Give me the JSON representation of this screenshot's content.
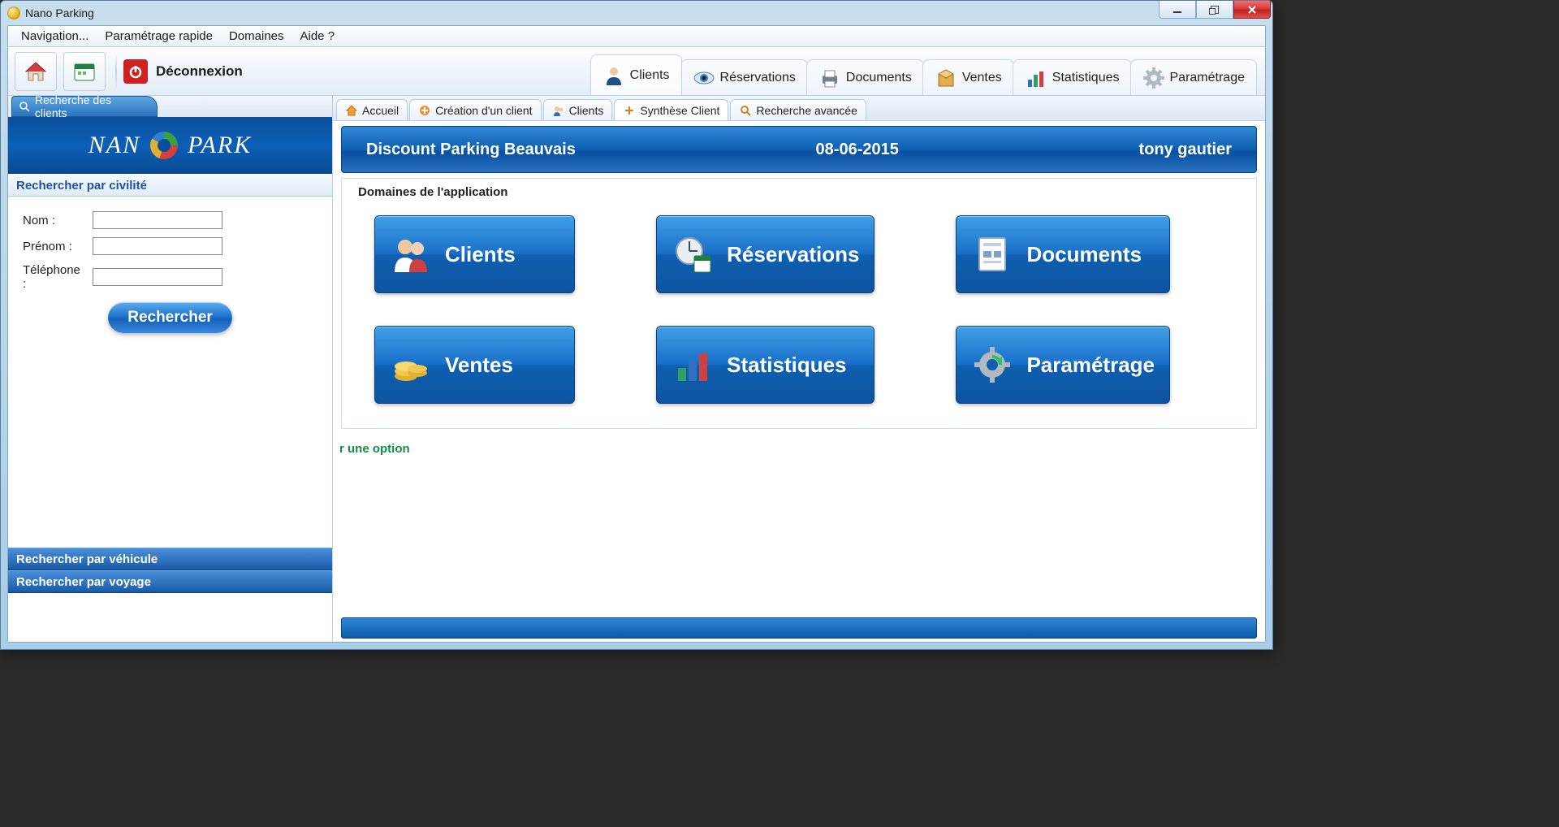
{
  "window": {
    "title": "Nano Parking"
  },
  "menubar": {
    "navigation": "Navigation...",
    "quick_settings": "Paramétrage rapide",
    "domains": "Domaines",
    "help": "Aide ?"
  },
  "toolbar": {
    "logout_label": "Déconnexion",
    "tabs": {
      "clients": "Clients",
      "reservations": "Réservations",
      "documents": "Documents",
      "ventes": "Ventes",
      "stats": "Statistiques",
      "settings": "Paramétrage"
    }
  },
  "sidebar": {
    "tab_label": "Recherche des clients",
    "logo_left": "NAN",
    "logo_right": "PARK",
    "sections": {
      "civilite": "Rechercher par civilité",
      "vehicule": "Rechercher par véhicule",
      "voyage": "Rechercher par voyage"
    },
    "form": {
      "nom_label": "Nom :",
      "prenom_label": "Prénom :",
      "tel_label": "Téléphone :",
      "search_btn": "Rechercher"
    }
  },
  "doc_tabs": {
    "accueil": "Accueil",
    "creation": "Création d'un client",
    "clients": "Clients",
    "synthese": "Synthèse Client",
    "recherche": "Recherche avancée"
  },
  "banner": {
    "company": "Discount Parking Beauvais",
    "date": "08-06-2015",
    "user": "tony gautier"
  },
  "panel": {
    "title": "Domaines de l'application",
    "tiles": {
      "clients": "Clients",
      "reservations": "Réservations",
      "documents": "Documents",
      "ventes": "Ventes",
      "stats": "Statistiques",
      "settings": "Paramétrage"
    }
  },
  "hint": "r une option"
}
